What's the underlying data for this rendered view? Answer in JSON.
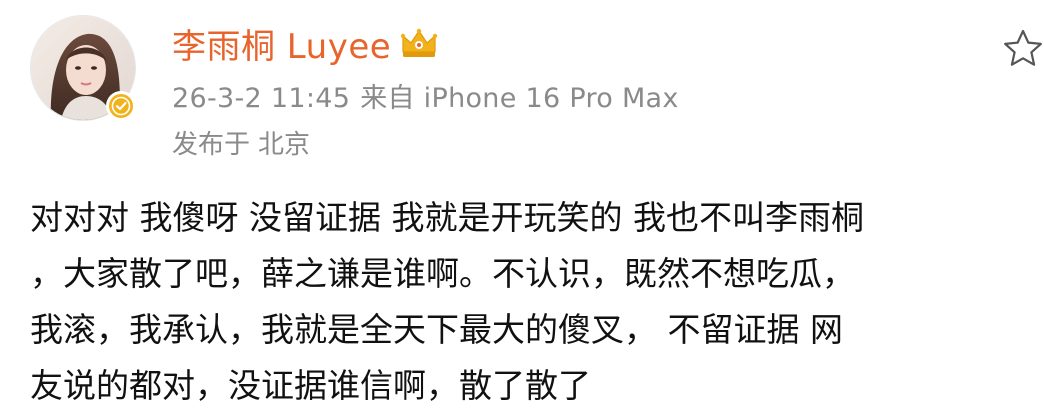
{
  "post": {
    "author": {
      "name": "李雨桐 Luyee",
      "avatar": "avatar",
      "verified_icon": "verified-badge-icon",
      "vip_icon": "crown-badge-icon"
    },
    "timestamp": "26-3-2 11:45",
    "source": "来自 iPhone 16 Pro Max",
    "location_prefix": "发布于",
    "location": "北京",
    "favorite_icon": "star-outline-icon",
    "content_lines": [
      "对对对 我傻呀 没留证据 我就是开玩笑的 我也不叫李雨桐",
      "，大家散了吧，薛之谦是谁啊。不认识，既然不想吃瓜，",
      "我滚，我承认，我就是全天下最大的傻叉， 不留证据 网",
      "友说的都对，没证据谁信啊，散了散了"
    ]
  },
  "colors": {
    "username": "#e8642c",
    "meta": "#8a8a8a",
    "body_text": "#111111",
    "badge_gold": "#f2b21b"
  }
}
